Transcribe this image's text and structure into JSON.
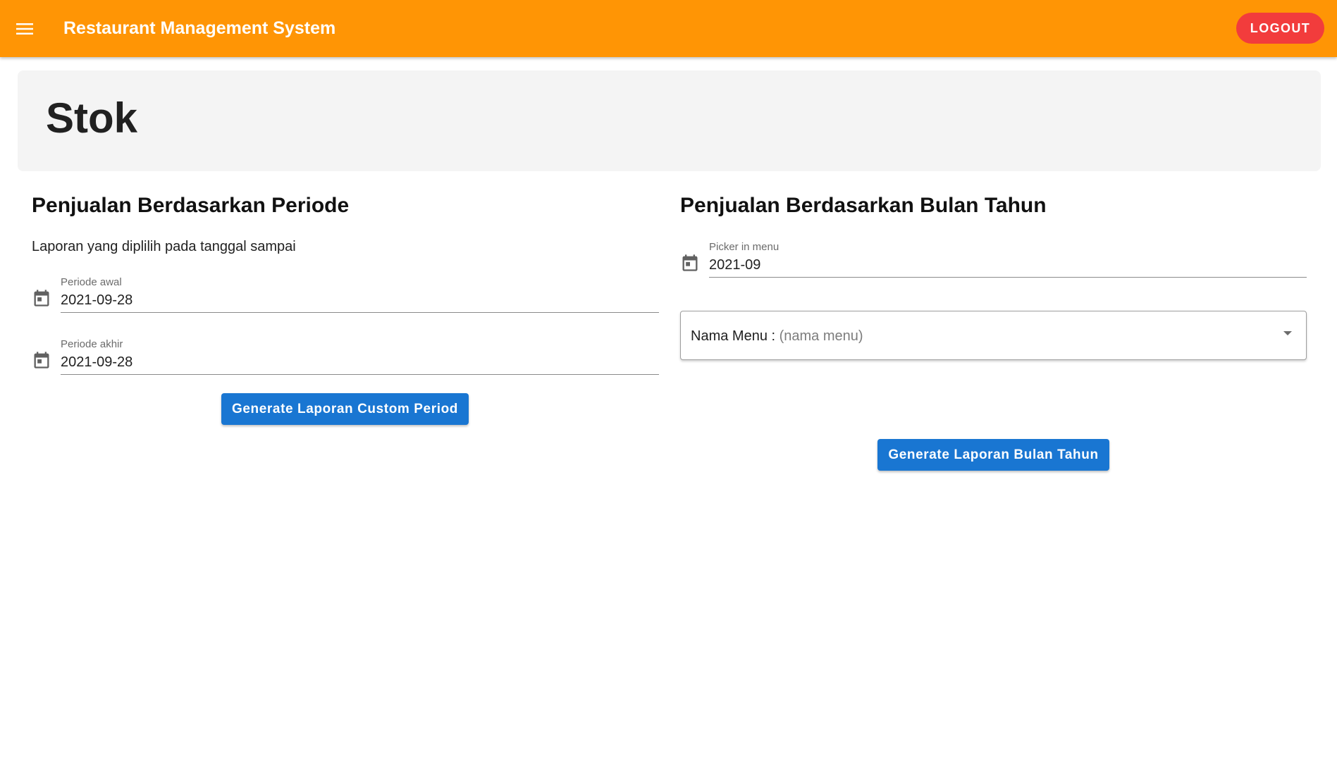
{
  "appbar": {
    "menu_icon": "hamburger-menu-icon",
    "title": "Restaurant Management System",
    "logout_label": "LOGOUT",
    "background_color": "#ff9505",
    "logout_color": "#f23c3c"
  },
  "page": {
    "title": "Stok"
  },
  "period_section": {
    "title": "Penjualan Berdasarkan Periode",
    "description": "Laporan yang diplilih pada tanggal sampai",
    "start_field": {
      "icon": "calendar-icon",
      "label": "Periode awal",
      "value": "2021-09-28"
    },
    "end_field": {
      "icon": "calendar-icon",
      "label": "Periode akhir",
      "value": "2021-09-28"
    },
    "button_label": "Generate Laporan Custom Period"
  },
  "month_section": {
    "title": "Penjualan Berdasarkan Bulan Tahun",
    "picker_field": {
      "icon": "calendar-icon",
      "label": "Picker in menu",
      "value": "2021-09"
    },
    "menu_select": {
      "label": "Nama Menu : ",
      "placeholder": "(nama menu)",
      "icon": "dropdown-arrow-icon"
    },
    "button_label": "Generate Laporan Bulan Tahun"
  },
  "colors": {
    "primary_button": "#1976d2",
    "header_card": "#f4f4f4"
  }
}
